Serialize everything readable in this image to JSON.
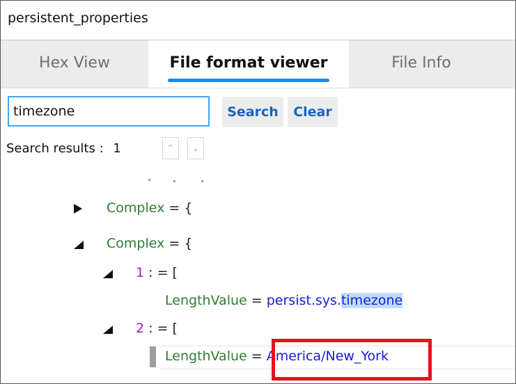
{
  "window": {
    "title": "persistent_properties"
  },
  "tabs": [
    {
      "label": "Hex View",
      "active": false
    },
    {
      "label": "File format viewer",
      "active": true
    },
    {
      "label": "File Info",
      "active": false
    }
  ],
  "search": {
    "value": "timezone",
    "search_label": "Search",
    "clear_label": "Clear",
    "results_label": "Search results :",
    "results_count": "1"
  },
  "tree": {
    "row1": {
      "key": "Complex",
      "op": "= {",
      "state": "collapsed"
    },
    "row2": {
      "key": "Complex",
      "op": "= {",
      "state": "expanded"
    },
    "row3": {
      "index": "1",
      "op": ": = [",
      "state": "expanded"
    },
    "row4": {
      "key": "LengthValue",
      "op": "=",
      "value_prefix": "persist.sys.",
      "value_match": "timezone"
    },
    "row5": {
      "index": "2",
      "op": ": = [",
      "state": "expanded"
    },
    "row6": {
      "key": "LengthValue",
      "op": "=",
      "value": "America/New_York"
    }
  },
  "colors": {
    "accent": "#1e88e5",
    "key_green": "#2e7d32",
    "index_purple": "#9c27b0",
    "value_blue": "#1a1ad8",
    "highlight_box": "#e0151c"
  },
  "icons": {
    "collapsed": "triangle-right-icon",
    "expanded": "triangle-down-left-icon",
    "prev": "chevron-up-icon",
    "next": "chevron-down-icon"
  }
}
